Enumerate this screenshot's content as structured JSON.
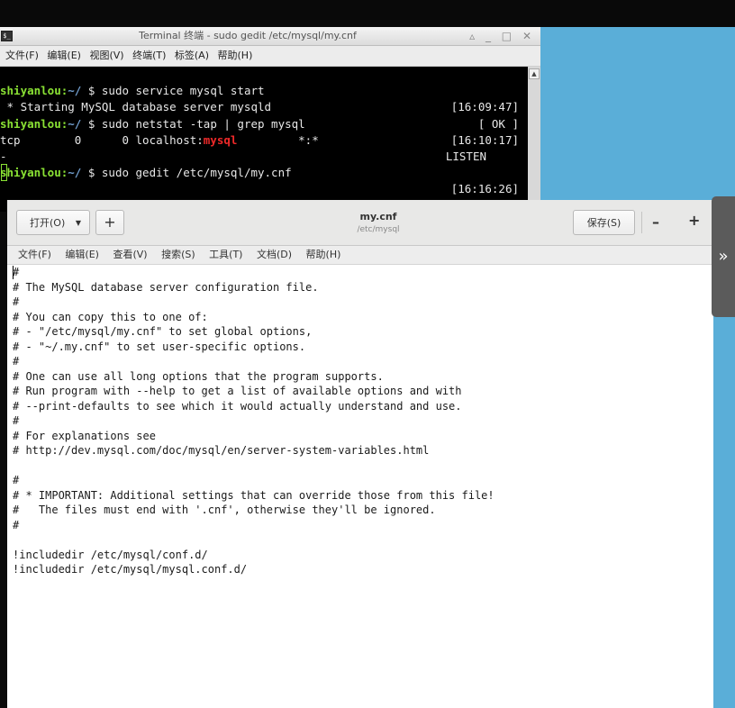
{
  "terminal": {
    "title": "Terminal 终端 - sudo gedit /etc/mysql/my.cnf",
    "icon": "terminal-icon",
    "window_buttons": "▵ _ □ ✕",
    "menu": [
      "文件(F)",
      "编辑(E)",
      "视图(V)",
      "终端(T)",
      "标签(A)",
      "帮助(H)"
    ],
    "lines": [
      {
        "user": "shiyanlou:",
        "path": "~/",
        "cmd": " $ sudo service mysql start",
        "time": "[16:09:47]"
      },
      {
        "text": " * Starting MySQL database server mysqld",
        "time": "[ OK ]"
      },
      {
        "user": "shiyanlou:",
        "path": "~/",
        "cmd": " $ sudo netstat -tap | grep mysql",
        "time": "[16:10:17]"
      },
      {
        "pre": "tcp        0      0 localhost:",
        "highlight": "mysql",
        "post": "         *:*",
        "time": "LISTEN"
      },
      {
        "text": "-"
      },
      {
        "user": "shiyanlou:",
        "path": "~/",
        "cmd": " $ sudo gedit /etc/mysql/my.cnf",
        "time": "[16:16:26]"
      }
    ],
    "scroll_up_icon": "▲"
  },
  "gedit": {
    "open_label": "打开(O)",
    "open_arrow": "▼",
    "new_tab_label": "+",
    "doc_title": "my.cnf",
    "doc_path": "/etc/mysql",
    "save_label": "保存(S)",
    "zoom_out_label": "–",
    "zoom_in_label": "+",
    "menu": [
      "文件(F)",
      "编辑(E)",
      "查看(V)",
      "搜索(S)",
      "工具(T)",
      "文档(D)",
      "帮助(H)"
    ],
    "content": [
      "#",
      "# The MySQL database server configuration file.",
      "#",
      "# You can copy this to one of:",
      "# - \"/etc/mysql/my.cnf\" to set global options,",
      "# - \"~/.my.cnf\" to set user-specific options.",
      "#",
      "# One can use all long options that the program supports.",
      "# Run program with --help to get a list of available options and with",
      "# --print-defaults to see which it would actually understand and use.",
      "#",
      "# For explanations see",
      "# http://dev.mysql.com/doc/mysql/en/server-system-variables.html",
      "",
      "#",
      "# * IMPORTANT: Additional settings that can override those from this file!",
      "#   The files must end with '.cnf', otherwise they'll be ignored.",
      "#",
      "",
      "!includedir /etc/mysql/conf.d/",
      "!includedir /etc/mysql/mysql.conf.d/"
    ]
  },
  "side_tab_label": "»"
}
